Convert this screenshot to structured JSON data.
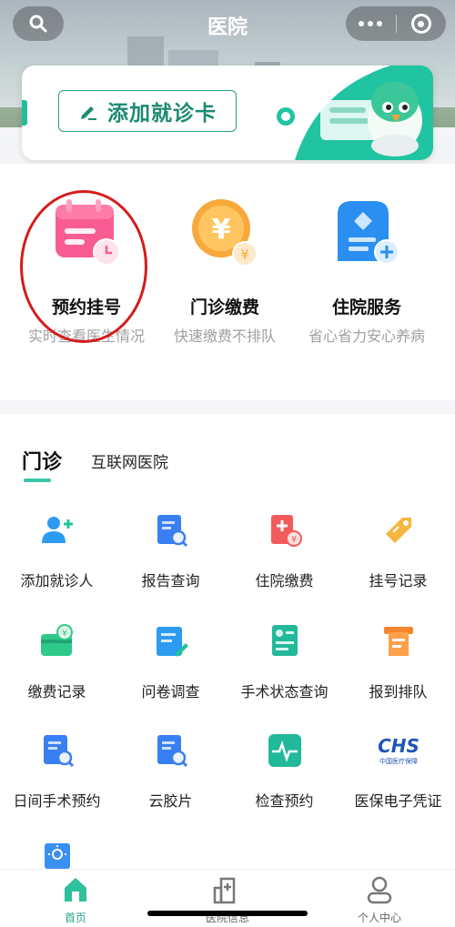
{
  "nav": {
    "title": "医院"
  },
  "banner": {
    "add_card_label": "添加就诊卡"
  },
  "services": [
    {
      "name": "预约挂号",
      "desc": "实时查看医生情况",
      "icon": "calendar-icon"
    },
    {
      "name": "门诊缴费",
      "desc": "快速缴费不排队",
      "icon": "yuan-coin-icon"
    },
    {
      "name": "住院服务",
      "desc": "省心省力安心养病",
      "icon": "hospital-bed-icon"
    }
  ],
  "outpatient": {
    "tabs": [
      "门诊",
      "互联网医院"
    ],
    "items": [
      {
        "label": "添加就诊人",
        "icon": "add-person-icon"
      },
      {
        "label": "报告查询",
        "icon": "report-search-icon"
      },
      {
        "label": "住院缴费",
        "icon": "inpatient-payment-icon"
      },
      {
        "label": "挂号记录",
        "icon": "tag-icon"
      },
      {
        "label": "缴费记录",
        "icon": "payment-record-icon"
      },
      {
        "label": "问卷调查",
        "icon": "survey-icon"
      },
      {
        "label": "手术状态查询",
        "icon": "surgery-status-icon"
      },
      {
        "label": "报到排队",
        "icon": "queue-ticket-icon"
      },
      {
        "label": "日间手术预约",
        "icon": "day-surgery-icon"
      },
      {
        "label": "云胶片",
        "icon": "cloud-film-icon"
      },
      {
        "label": "检查预约",
        "icon": "exam-monitor-icon"
      },
      {
        "label": "医保电子凭证",
        "icon": "chs-logo-icon",
        "logo_text": "CHS",
        "logo_sub": "中国医疗保障"
      },
      {
        "label": "",
        "icon": "light-icon"
      }
    ]
  },
  "tabbar": [
    {
      "label": "首页",
      "icon": "home-icon",
      "active": true
    },
    {
      "label": "医院信息",
      "icon": "hospital-icon",
      "active": false
    },
    {
      "label": "个人中心",
      "icon": "user-icon",
      "active": false
    }
  ],
  "colors": {
    "accent": "#27a68b",
    "annotation": "#d41c1c"
  }
}
